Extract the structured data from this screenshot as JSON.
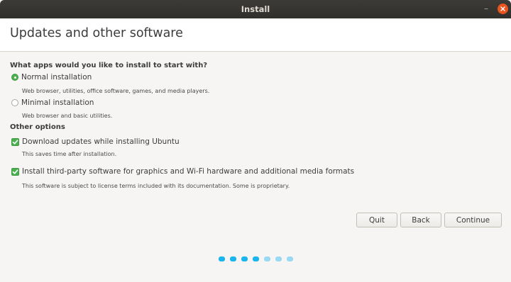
{
  "window": {
    "title": "Install",
    "minimize_glyph": "–"
  },
  "header": {
    "title": "Updates and other software"
  },
  "install_question": "What apps would you like to install to start with?",
  "installation_options": [
    {
      "label": "Normal installation",
      "description": "Web browser, utilities, office software, games, and media players.",
      "selected": true
    },
    {
      "label": "Minimal installation",
      "description": "Web browser and basic utilities.",
      "selected": false
    }
  ],
  "other_options": {
    "heading": "Other options",
    "items": [
      {
        "label": "Download updates while installing Ubuntu",
        "description": "This saves time after installation.",
        "checked": true
      },
      {
        "label": "Install third-party software for graphics and Wi-Fi hardware and additional media formats",
        "description": "This software is subject to license terms included with its documentation. Some is proprietary.",
        "checked": true
      }
    ]
  },
  "buttons": {
    "quit": "Quit",
    "back": "Back",
    "continue": "Continue"
  },
  "progress": {
    "total_steps": 7,
    "completed_steps": 4
  },
  "colors": {
    "accent_green": "#4caf50",
    "close_orange": "#e9541f",
    "progress_done": "#19b6ee",
    "progress_todo": "#9ad9f3"
  },
  "icons": {
    "close": "close-icon",
    "minimize": "minimize-icon",
    "check": "check-icon"
  }
}
